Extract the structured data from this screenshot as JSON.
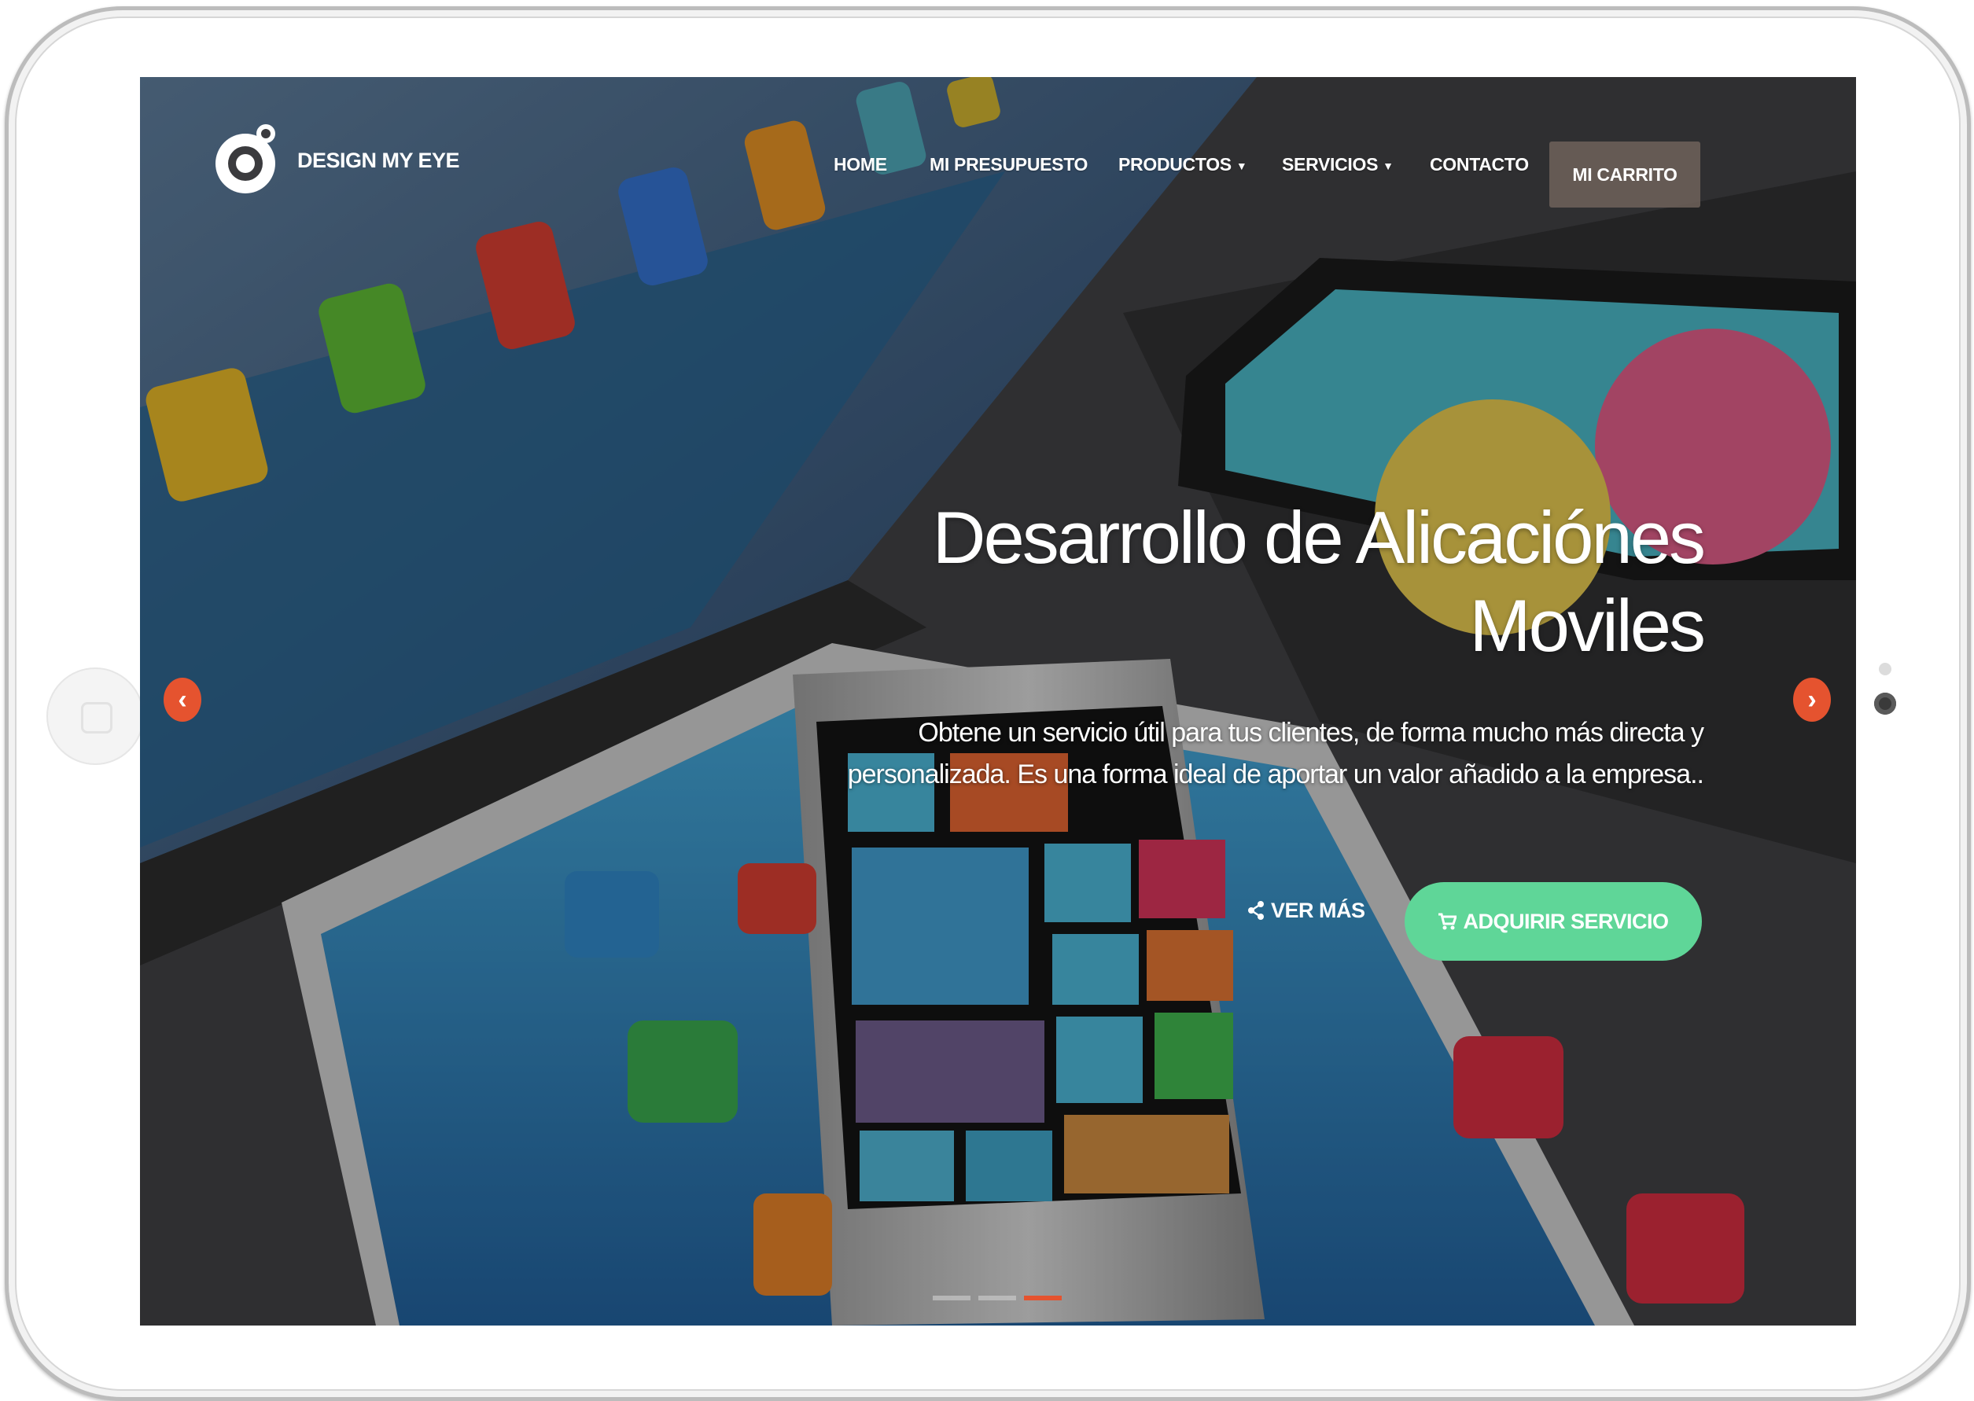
{
  "brand": {
    "name": "DESIGN MY EYE",
    "logo_icon": "eye-logo-icon"
  },
  "nav": {
    "items": [
      {
        "label": "HOME",
        "has_dropdown": false
      },
      {
        "label": "MI PRESUPUESTO",
        "has_dropdown": false
      },
      {
        "label": "PRODUCTOS",
        "has_dropdown": true
      },
      {
        "label": "SERVICIOS",
        "has_dropdown": true
      },
      {
        "label": "CONTACTO",
        "has_dropdown": false
      }
    ],
    "cart_label": "MI CARRITO"
  },
  "hero": {
    "title_line1": "Desarrollo de Alicaciónes",
    "title_line2": "Moviles",
    "subtitle": "Obtene un servicio útil para tus clientes, de forma mucho más directa y personalizada. Es una forma ideal de aportar un valor añadido a la empresa..",
    "more_label": "VER MÁS",
    "more_icon": "share-icon",
    "buy_label": "ADQUIRIR SERVICIO",
    "buy_icon": "cart-icon"
  },
  "carousel": {
    "prev_icon": "chevron-left-icon",
    "next_icon": "chevron-right-icon",
    "slide_count": 3,
    "active_index": 2
  },
  "colors": {
    "accent": "#e5532f",
    "button_green": "#5fd698",
    "cart_bg": "#6e625a"
  }
}
